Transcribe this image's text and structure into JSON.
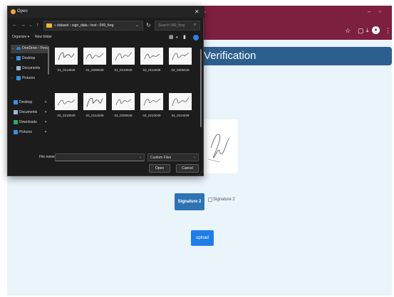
{
  "dialog": {
    "title": "Open",
    "close_glyph": "✕",
    "nav_back": "←",
    "nav_forward": "→",
    "nav_up": "↑",
    "address_path": "« dataset › sign_data › test › 049_forg",
    "refresh_glyph": "↻",
    "search_placeholder": "Search 049_forg",
    "organize_label": "Organize ▾",
    "new_folder_label": "New folder",
    "nav_items": [
      {
        "label": "OneDrive - Pers",
        "icon": "cloud-icon",
        "color": "#2f80e4",
        "selected": true
      },
      {
        "label": "Desktop",
        "icon": "desktop-folder-icon",
        "color": "#3a8fe0"
      },
      {
        "label": "Documents",
        "icon": "documents-folder-icon",
        "color": "#9fb6d6"
      },
      {
        "label": "Pictures",
        "icon": "pictures-folder-icon",
        "color": "#3a8fe0"
      },
      {
        "label": "Desktop",
        "icon": "desktop-folder-icon",
        "color": "#3a8fe0",
        "pinned": true
      },
      {
        "label": "Documents",
        "icon": "documents-folder-icon",
        "color": "#9fb6d6",
        "pinned": true
      },
      {
        "label": "Downloads",
        "icon": "downloads-folder-icon",
        "color": "#2fa867",
        "pinned": true
      },
      {
        "label": "Pictures",
        "icon": "pictures-folder-icon",
        "color": "#3a8fe0",
        "pinned": true
      }
    ],
    "files": [
      {
        "name": "01_0114049"
      },
      {
        "name": "01_0206049"
      },
      {
        "name": "01_0210049"
      },
      {
        "name": "02_0114049"
      },
      {
        "name": "02_0206049"
      },
      {
        "name": "02_0210049"
      },
      {
        "name": "03_0114049"
      },
      {
        "name": "03_0206049"
      },
      {
        "name": "03_0210049"
      },
      {
        "name": "04_0114049"
      }
    ],
    "file_name_label": "File name:",
    "file_name_value": "",
    "filter_value": "Custom Files",
    "open_label": "Open",
    "cancel_label": "Cancel"
  },
  "page": {
    "header_title": "Verification",
    "signature_button": "Signature 2",
    "broken_image_alt": "Signature 2",
    "upload_button": "upload"
  },
  "colors": {
    "browser_frame": "#7d1f3f",
    "page_bg": "#eaf4fb",
    "header_bar": "#2d5f8e",
    "signature_button": "#2e74b5",
    "upload_button": "#1f7de6",
    "dialog_bg": "#1c1c1c"
  }
}
